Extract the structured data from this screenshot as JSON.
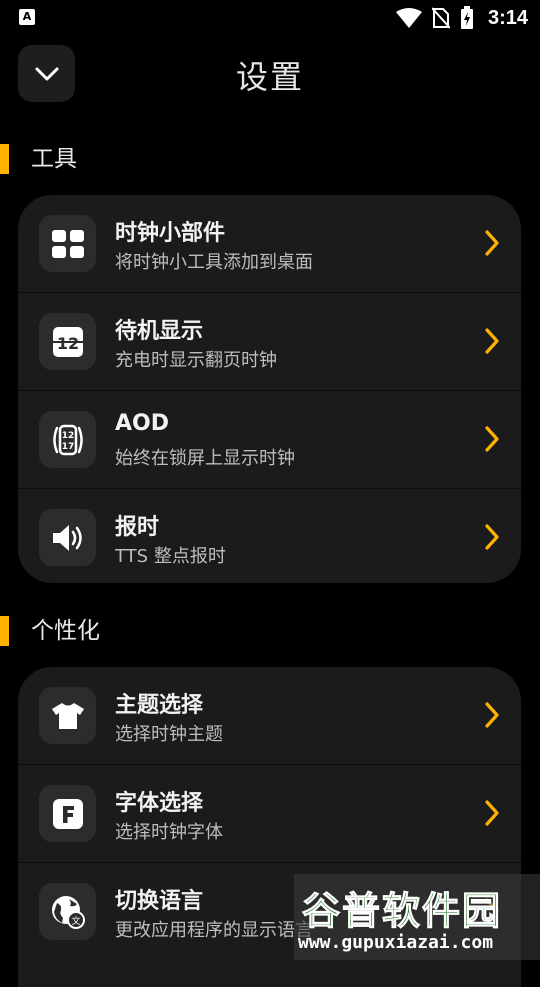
{
  "status_bar": {
    "time": "3:14",
    "icons": [
      "app-notification-icon",
      "wifi-icon",
      "no-sim-icon",
      "battery-charging-icon"
    ]
  },
  "header": {
    "title": "设置",
    "back_icon": "chevron-down-icon"
  },
  "accent_color": "#ffb300",
  "sections": [
    {
      "title": "工具",
      "items": [
        {
          "icon": "widgets-icon",
          "title": "时钟小部件",
          "subtitle": "将时钟小工具添加到桌面"
        },
        {
          "icon": "flip-clock-icon",
          "title": "待机显示",
          "subtitle": "充电时显示翻页时钟"
        },
        {
          "icon": "watch-icon",
          "title": "AOD",
          "subtitle": "始终在锁屏上显示时钟"
        },
        {
          "icon": "speaker-icon",
          "title": "报时",
          "subtitle": "TTS 整点报时"
        }
      ]
    },
    {
      "title": "个性化",
      "items": [
        {
          "icon": "tshirt-icon",
          "title": "主题选择",
          "subtitle": "选择时钟主题"
        },
        {
          "icon": "font-icon",
          "title": "字体选择",
          "subtitle": "选择时钟字体"
        },
        {
          "icon": "globe-translate-icon",
          "title": "切换语言",
          "subtitle": "更改应用程序的显示语言"
        }
      ]
    }
  ],
  "watermark": {
    "text": "谷普软件园",
    "url": "www.gupuxiazai.com"
  }
}
